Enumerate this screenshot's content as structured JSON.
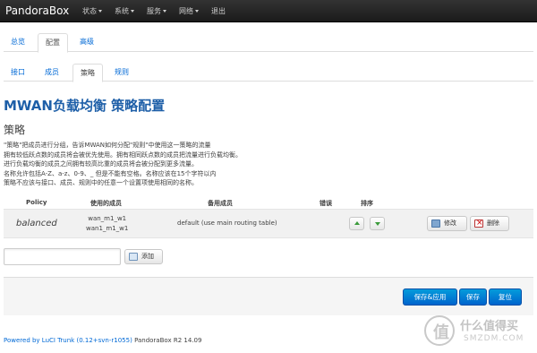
{
  "navbar": {
    "brand": "PandoraBox",
    "menu": [
      {
        "label": "状态",
        "dropdown": true
      },
      {
        "label": "系统",
        "dropdown": true
      },
      {
        "label": "服务",
        "dropdown": true
      },
      {
        "label": "网络",
        "dropdown": true
      },
      {
        "label": "退出",
        "dropdown": false
      }
    ]
  },
  "main_tabs": [
    {
      "label": "总览",
      "active": false
    },
    {
      "label": "配置",
      "active": true
    },
    {
      "label": "高级",
      "active": false
    }
  ],
  "sub_tabs": [
    {
      "label": "接口",
      "active": false
    },
    {
      "label": "成员",
      "active": false
    },
    {
      "label": "策略",
      "active": true
    },
    {
      "label": "规则",
      "active": false
    }
  ],
  "page_title": "MWAN负载均衡 策略配置",
  "section_title": "策略",
  "description": [
    "\"策略\"把成员进行分组，告诉MWAN如何分配\"规则\"中使用这一策略的流量",
    "拥有较低跃点数的成员将会被优先使用。拥有相同跃点数的成员把流量进行负载均衡。",
    "进行负载均衡的成员之间拥有较高比重的成员将会被分配到更多流量。",
    "名称允许包括A-Z、a-z、0-9、_ 但是不能有空格。名称应该在15个字符以内",
    "策略不应该与接口、成员、规则中的任意一个设置项使用相同的名称。"
  ],
  "table": {
    "headers": {
      "policy": "Policy",
      "members": "使用的成员",
      "last_resort": "备用成员",
      "errors": "错误",
      "sort": "排序"
    },
    "rows": [
      {
        "policy": "balanced",
        "members": [
          "wan_m1_w1",
          "wan1_m1_w1"
        ],
        "last_resort": "default (use main routing table)",
        "errors": "",
        "edit_label": "修改",
        "delete_label": "删除"
      }
    ]
  },
  "add_section": {
    "input_value": "",
    "button_label": "添加"
  },
  "actions": {
    "save_apply": "保存&应用",
    "save": "保存",
    "reset": "复位"
  },
  "footer": {
    "link": "Powered by LuCI Trunk (0.12+svn-r1055)",
    "text": "PandoraBox R2 14.09"
  },
  "watermark": {
    "glyph": "值",
    "text": "什么值得买",
    "sub": "SMZDM.COM"
  },
  "colors": {
    "navbar_bg": "#1f1f1f",
    "title_blue": "#1e5fa8",
    "link_blue": "#0069d6",
    "primary_button": "#0064cd",
    "sort_arrow_green": "#3a9a3a"
  }
}
